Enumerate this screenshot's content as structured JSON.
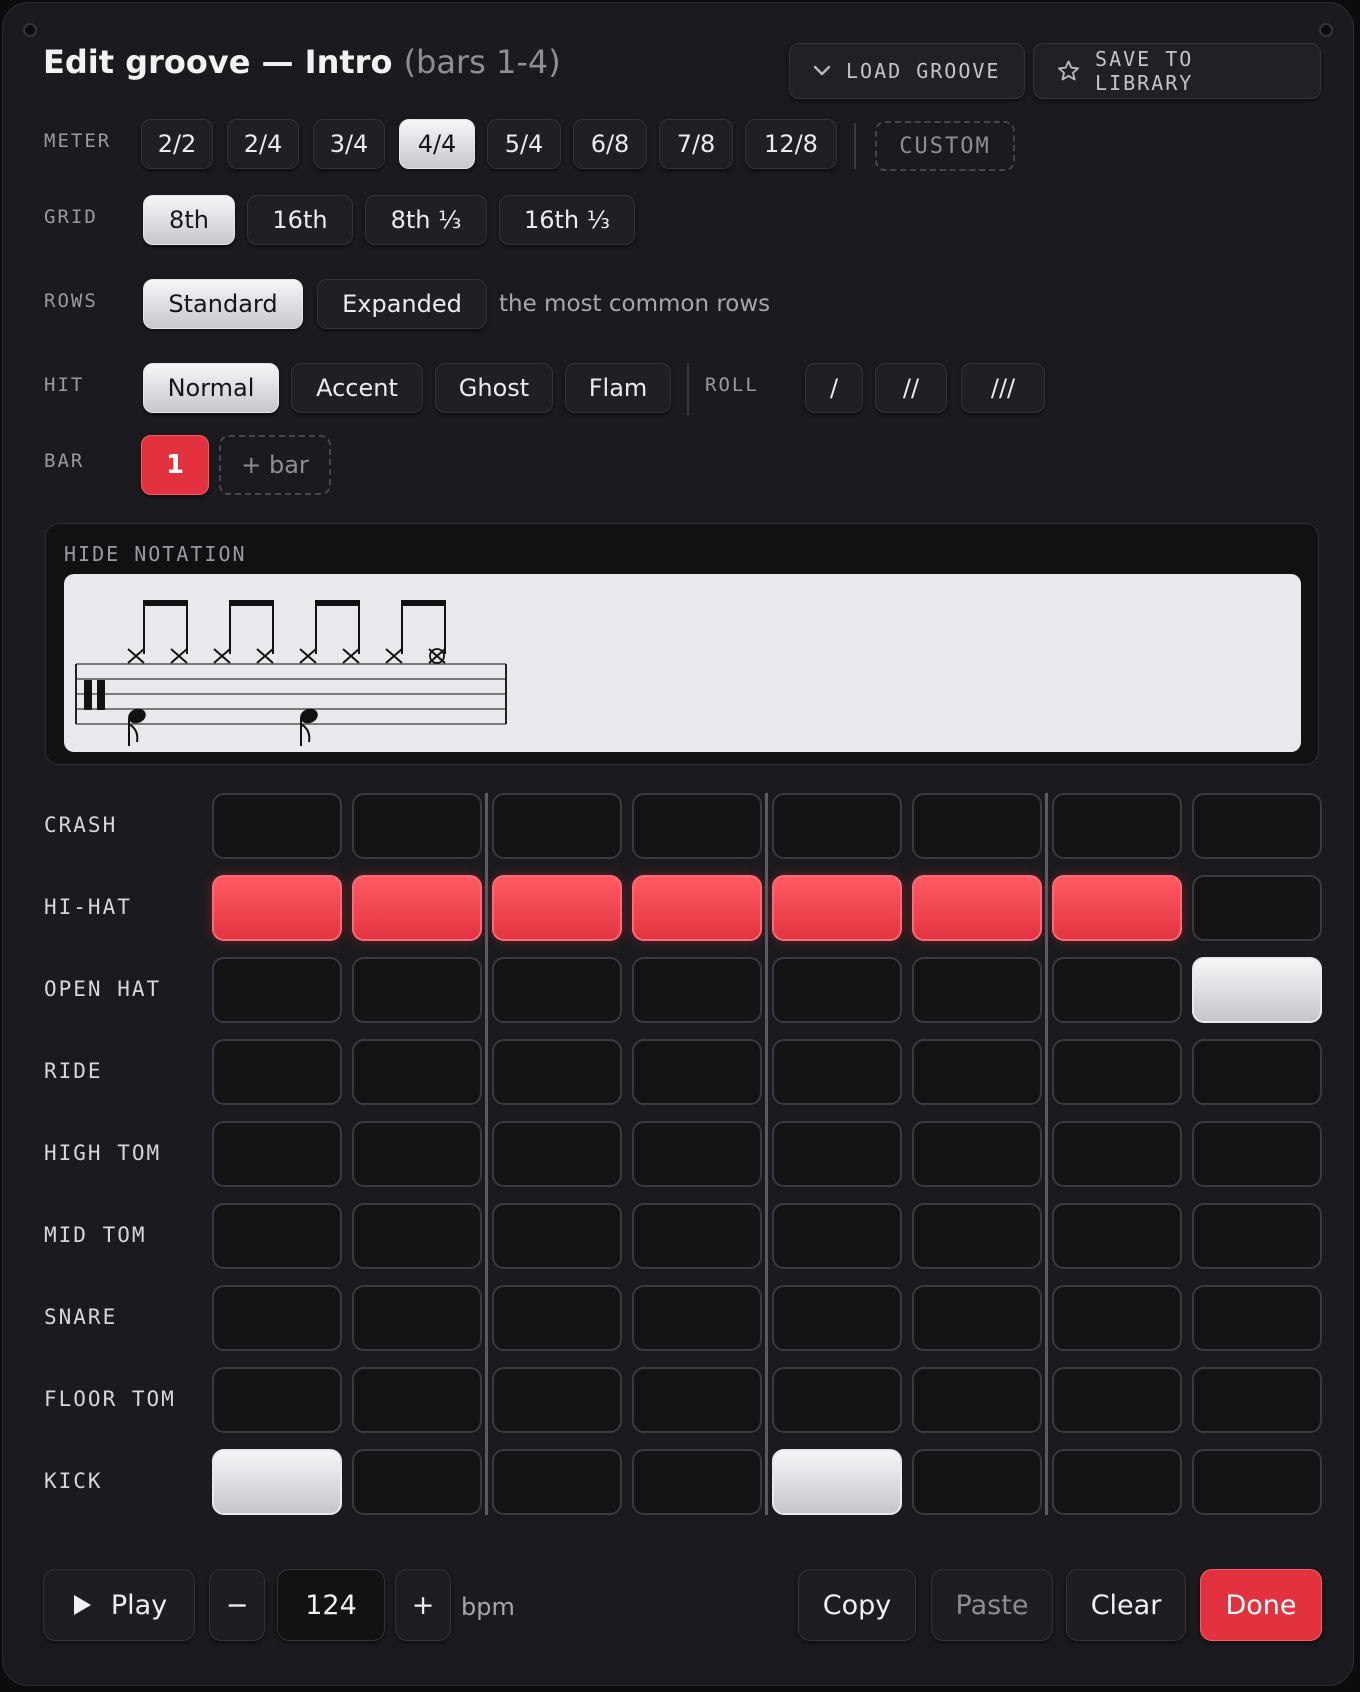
{
  "header": {
    "title": "Edit groove — Intro",
    "subtitle": "(bars 1-4)",
    "load_label": "LOAD GROOVE",
    "save_label": "SAVE TO LIBRARY"
  },
  "meter": {
    "label": "METER",
    "options": [
      "2/2",
      "2/4",
      "3/4",
      "4/4",
      "5/4",
      "6/8",
      "7/8",
      "12/8"
    ],
    "selected": "4/4",
    "custom_label": "CUSTOM"
  },
  "grid": {
    "label": "GRID",
    "options": [
      "8th",
      "16th",
      "8th ⅓",
      "16th ⅓"
    ],
    "selected": "8th"
  },
  "rows": {
    "label": "ROWS",
    "options": [
      "Standard",
      "Expanded"
    ],
    "selected": "Standard",
    "hint": "the most common rows"
  },
  "hit": {
    "label": "HIT",
    "options": [
      "Normal",
      "Accent",
      "Ghost",
      "Flam"
    ],
    "selected": "Normal",
    "roll_label": "ROLL",
    "roll_options": [
      "/",
      "//",
      "///"
    ]
  },
  "bar": {
    "label": "BAR",
    "current": "1",
    "add_label": "+ bar"
  },
  "notation": {
    "toggle_label": "HIDE NOTATION"
  },
  "sequencer": {
    "steps": 8,
    "rows": [
      {
        "name": "CRASH",
        "pattern": [
          0,
          0,
          0,
          0,
          0,
          0,
          0,
          0
        ]
      },
      {
        "name": "HI-HAT",
        "pattern": [
          1,
          1,
          1,
          1,
          1,
          1,
          1,
          0
        ]
      },
      {
        "name": "OPEN HAT",
        "pattern": [
          0,
          0,
          0,
          0,
          0,
          0,
          0,
          2
        ]
      },
      {
        "name": "RIDE",
        "pattern": [
          0,
          0,
          0,
          0,
          0,
          0,
          0,
          0
        ]
      },
      {
        "name": "HIGH TOM",
        "pattern": [
          0,
          0,
          0,
          0,
          0,
          0,
          0,
          0
        ]
      },
      {
        "name": "MID TOM",
        "pattern": [
          0,
          0,
          0,
          0,
          0,
          0,
          0,
          0
        ]
      },
      {
        "name": "SNARE",
        "pattern": [
          0,
          0,
          0,
          0,
          0,
          0,
          0,
          0
        ]
      },
      {
        "name": "FLOOR TOM",
        "pattern": [
          0,
          0,
          0,
          0,
          0,
          0,
          0,
          0
        ]
      },
      {
        "name": "KICK",
        "pattern": [
          2,
          0,
          0,
          0,
          2,
          0,
          0,
          0
        ]
      }
    ]
  },
  "transport": {
    "play_label": "Play",
    "minus_label": "−",
    "tempo": "124",
    "plus_label": "+",
    "tempo_unit": "bpm",
    "copy_label": "Copy",
    "paste_label": "Paste",
    "clear_label": "Clear",
    "done_label": "Done"
  },
  "colors": {
    "accent": "#e2323f",
    "background": "#1b1b1f",
    "cell_idle": "#141417",
    "cell_selected": "#f2f2f4"
  }
}
